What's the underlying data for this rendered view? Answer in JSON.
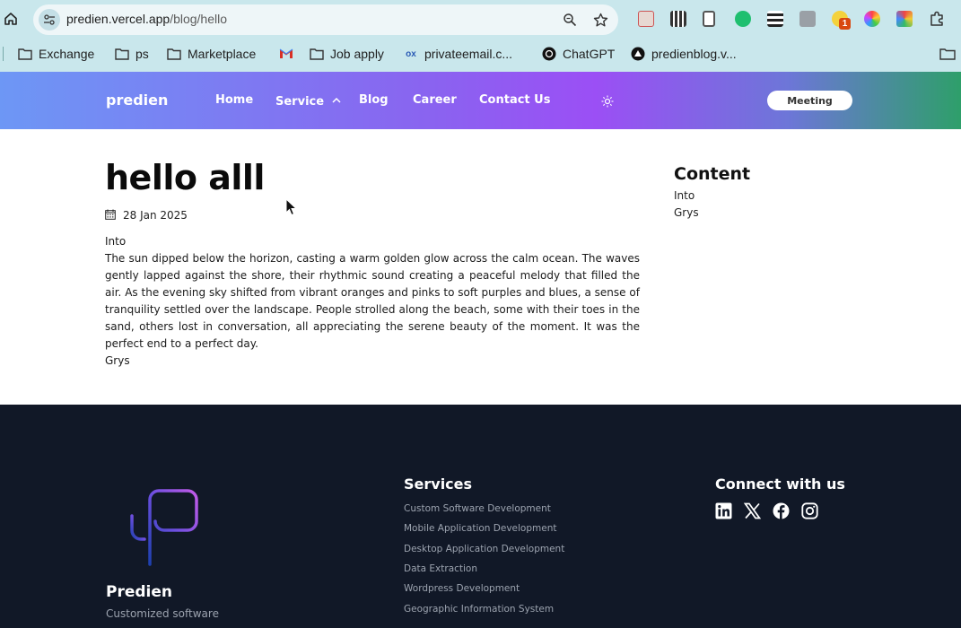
{
  "browser": {
    "url_host": "predien.vercel.app",
    "url_path": "/blog/hello",
    "extension_badge": "1",
    "bookmarks": [
      {
        "label": "Exchange",
        "icon": "folder-icon"
      },
      {
        "label": "ps",
        "icon": "folder-icon"
      },
      {
        "label": "Marketplace",
        "icon": "folder-icon"
      },
      {
        "label": "",
        "icon": "gmail-icon"
      },
      {
        "label": "Job apply",
        "icon": "folder-icon"
      },
      {
        "label": "privateemail.c...",
        "icon": "privateemail-icon"
      },
      {
        "label": "ChatGPT",
        "icon": "chatgpt-icon"
      },
      {
        "label": "predienblog.v...",
        "icon": "vercel-icon"
      }
    ]
  },
  "nav": {
    "brand": "predien",
    "links": [
      "Home",
      "Service",
      "Blog",
      "Career",
      "Contact Us"
    ],
    "meeting": "Meeting"
  },
  "post": {
    "title": "hello alll",
    "date": "28 Jan 2025",
    "section1_heading": "Into",
    "body": "The sun dipped below the horizon, casting a warm golden glow across the calm ocean. The waves gently lapped against the shore, their rhythmic sound creating a peaceful melody that filled the air. As the evening sky shifted from vibrant oranges and pinks to soft purples and blues, a sense of tranquility settled over the landscape. People strolled along the beach, some with their toes in the sand, others lost in conversation, all appreciating the serene beauty of the moment. It was the perfect end to a perfect day.",
    "section2_heading": "Grys"
  },
  "toc": {
    "title": "Content",
    "items": [
      "Into",
      "Grys"
    ]
  },
  "footer": {
    "brand": "Predien",
    "tagline": "Customized software",
    "services_title": "Services",
    "services": [
      "Custom Software Development",
      "Mobile Application Development",
      "Desktop Application Development",
      "Data Extraction",
      "Wordpress Development",
      "Geographic Information System"
    ],
    "connect_title": "Connect with us",
    "socials": [
      "linkedin-icon",
      "x-icon",
      "facebook-icon",
      "instagram-icon"
    ]
  },
  "colors": {
    "chrome_bg": "#c9e7ec",
    "footer_bg": "#111827",
    "nav_gradient_start": "#6d97f5",
    "nav_gradient_mid": "#9b4ff5",
    "nav_gradient_end": "#2e9f6a"
  }
}
